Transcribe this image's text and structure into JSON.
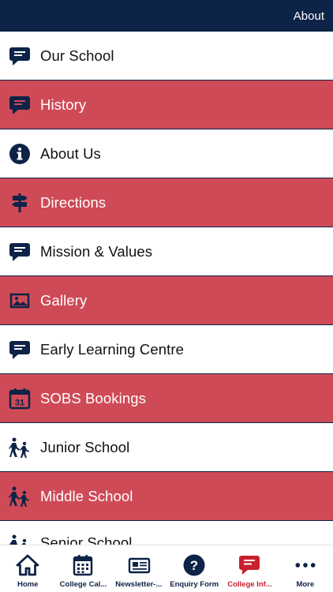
{
  "header": {
    "title": "About"
  },
  "colors": {
    "navy": "#0d2347",
    "red_row": "#cf4a57",
    "active_tab": "#c8202e"
  },
  "list": {
    "items": [
      {
        "label": "Our School",
        "icon": "speech-bubble-icon",
        "style": "white"
      },
      {
        "label": "History",
        "icon": "speech-bubble-icon",
        "style": "red"
      },
      {
        "label": "About Us",
        "icon": "info-icon",
        "style": "white"
      },
      {
        "label": "Directions",
        "icon": "signpost-icon",
        "style": "red"
      },
      {
        "label": "Mission & Values",
        "icon": "speech-bubble-icon",
        "style": "white"
      },
      {
        "label": "Gallery",
        "icon": "gallery-icon",
        "style": "red"
      },
      {
        "label": "Early Learning Centre",
        "icon": "speech-bubble-icon",
        "style": "white"
      },
      {
        "label": "SOBS Bookings",
        "icon": "calendar-icon",
        "style": "red"
      },
      {
        "label": "Junior School",
        "icon": "walking-people-icon",
        "style": "white"
      },
      {
        "label": "Middle School",
        "icon": "walking-people-icon",
        "style": "red"
      },
      {
        "label": "Senior School",
        "icon": "walking-people-icon",
        "style": "white"
      }
    ],
    "calendar_day": "31"
  },
  "tabbar": {
    "tabs": [
      {
        "label": "Home",
        "icon": "home-icon",
        "active": false
      },
      {
        "label": "College Cal...",
        "icon": "calendar-grid-icon",
        "active": false
      },
      {
        "label": "Newsletter-...",
        "icon": "newspaper-icon",
        "active": false
      },
      {
        "label": "Enquiry Form",
        "icon": "question-icon",
        "active": false
      },
      {
        "label": "College Inf...",
        "icon": "speech-bubble-icon",
        "active": true
      },
      {
        "label": "More",
        "icon": "more-dots-icon",
        "active": false
      }
    ]
  }
}
